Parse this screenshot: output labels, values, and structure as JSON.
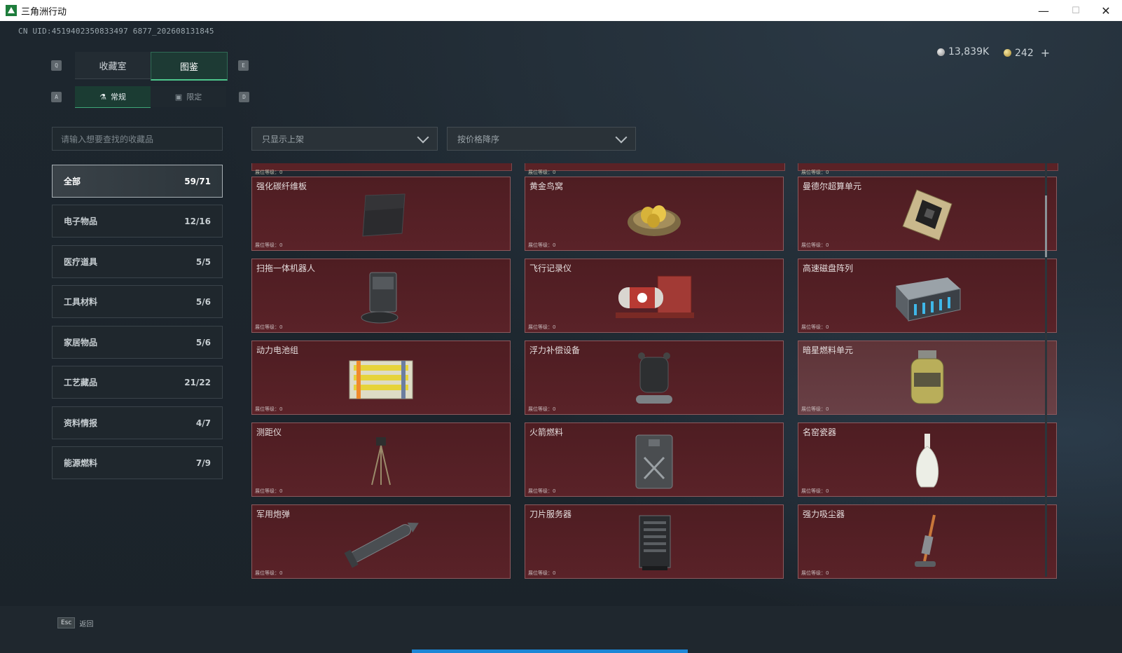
{
  "window": {
    "title": "三角洲行动",
    "minimize": "—",
    "maximize": "☐",
    "close": "✕"
  },
  "uid": "CN UID:4519402350833497 6877_202608131845",
  "currency": {
    "silver": "13,839K",
    "gold": "242",
    "add": "+"
  },
  "hints": {
    "q": "Q",
    "e": "E",
    "a": "A",
    "d": "D"
  },
  "tabs": [
    {
      "label": "收藏室"
    },
    {
      "label": "图鉴"
    }
  ],
  "subtabs": [
    {
      "label": "常规",
      "icon": "flask-icon"
    },
    {
      "label": "限定",
      "icon": "picture-icon"
    }
  ],
  "search": {
    "placeholder": "请输入想要查找的收藏品"
  },
  "filters": {
    "display": "只显示上架",
    "sort": "按价格降序"
  },
  "categories": [
    {
      "label": "全部",
      "count": "59/71"
    },
    {
      "label": "电子物品",
      "count": "12/16"
    },
    {
      "label": "医疗道具",
      "count": "5/5"
    },
    {
      "label": "工具材料",
      "count": "5/6"
    },
    {
      "label": "家居物品",
      "count": "5/6"
    },
    {
      "label": "工艺藏品",
      "count": "21/22"
    },
    {
      "label": "资料情报",
      "count": "4/7"
    },
    {
      "label": "能源燃料",
      "count": "7/9"
    }
  ],
  "level_label": "展位等级：0",
  "items": [
    {
      "name": "强化碳纤维板"
    },
    {
      "name": "黄金鸟窝"
    },
    {
      "name": "曼德尔超算单元"
    },
    {
      "name": "扫拖一体机器人"
    },
    {
      "name": "飞行记录仪"
    },
    {
      "name": "高速磁盘阵列"
    },
    {
      "name": "动力电池组"
    },
    {
      "name": "浮力补偿设备"
    },
    {
      "name": "暗星燃料单元"
    },
    {
      "name": "测距仪"
    },
    {
      "name": "火箭燃料"
    },
    {
      "name": "名窑瓷器"
    },
    {
      "name": "军用炮弹"
    },
    {
      "name": "刀片服务器"
    },
    {
      "name": "强力吸尘器"
    }
  ],
  "footer": {
    "esc_key": "Esc",
    "esc_label": "返回"
  },
  "colors": {
    "card_bg": "#5a2228",
    "accent_green": "#4ec68c",
    "progress_blue": "#1c86d6"
  }
}
